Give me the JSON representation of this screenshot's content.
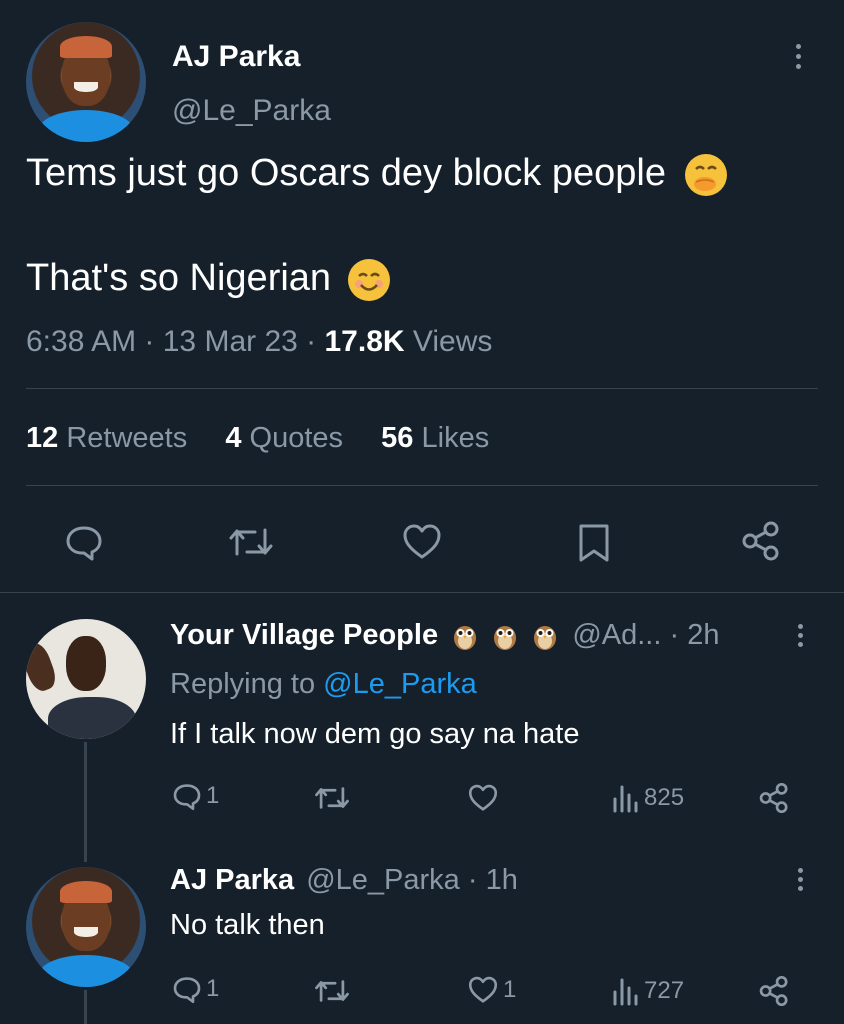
{
  "main_tweet": {
    "display_name": "AJ Parka",
    "handle": "@Le_Parka",
    "text_line1": "Tems just go Oscars dey block people",
    "text_line2": "That's so Nigerian",
    "time": "6:38 AM",
    "date": "13 Mar 23",
    "views_count": "17.8K",
    "views_label": "Views",
    "retweets_count": "12",
    "retweets_label": "Retweets",
    "quotes_count": "4",
    "quotes_label": "Quotes",
    "likes_count": "56",
    "likes_label": "Likes"
  },
  "reply1": {
    "display_name": "Your Village People",
    "handle": "@Ad...",
    "time": "2h",
    "replying_prefix": "Replying to",
    "replying_handle": "@Le_Parka",
    "text": "If I talk now dem go say na hate",
    "reply_count": "1",
    "views_count": "825"
  },
  "reply2": {
    "display_name": "AJ Parka",
    "handle": "@Le_Parka",
    "time": "1h",
    "text": "No talk then",
    "reply_count": "1",
    "like_count": "1",
    "views_count": "727"
  },
  "colors": {
    "background": "#15202b",
    "muted_text": "#8b98a5",
    "link": "#1d9bf0",
    "divider": "#38444d"
  },
  "icons": [
    "more-icon",
    "hand-over-mouth-emoji",
    "smiling-emoji",
    "reply-icon",
    "retweet-icon",
    "like-icon",
    "bookmark-icon",
    "share-icon",
    "owl-emoji",
    "views-icon"
  ]
}
